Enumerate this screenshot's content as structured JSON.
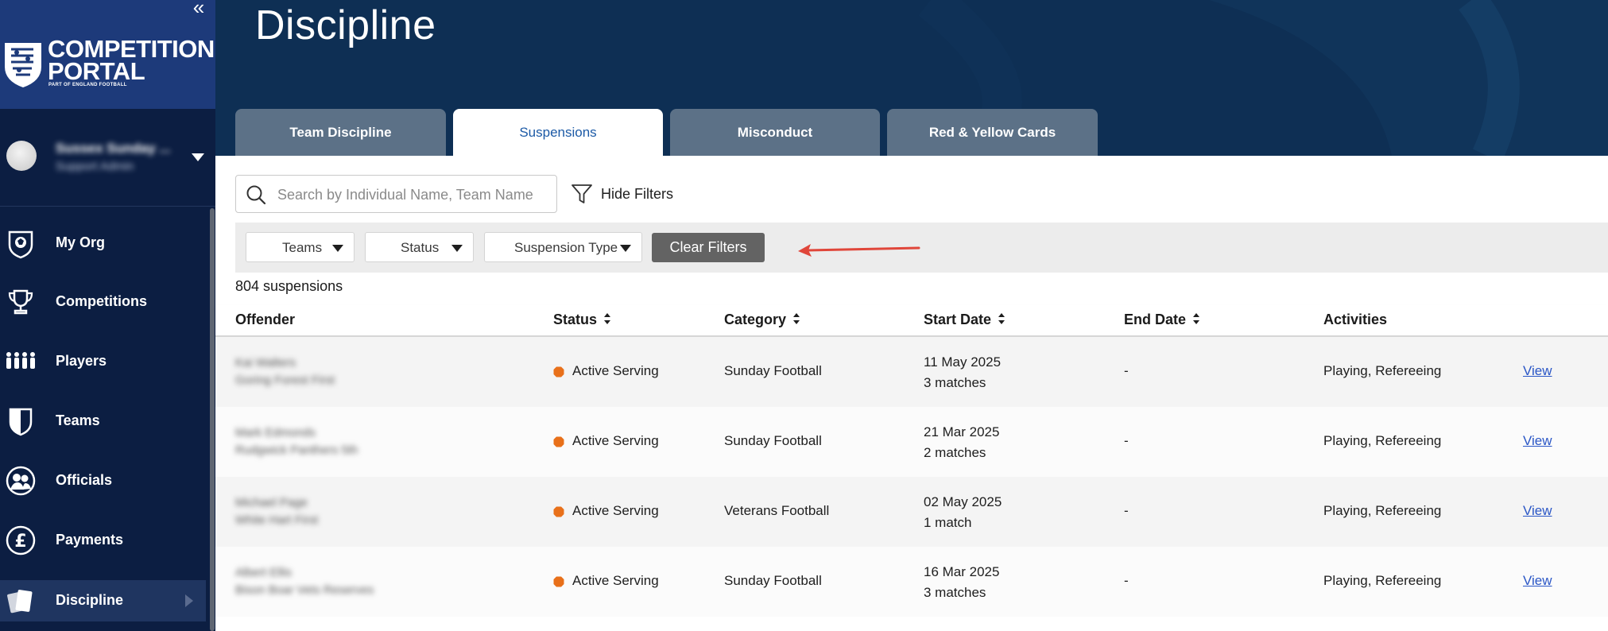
{
  "sidebar": {
    "collapse_glyph": "«",
    "logo": {
      "line1": "COMPETITION",
      "line2": "PORTAL",
      "subline": "PART OF ENGLAND FOOTBALL"
    },
    "user": {
      "name": "Sussex Sunday ...",
      "role": "Support Admin"
    },
    "nav": [
      {
        "label": "My Org",
        "icon": "shield-ball-icon"
      },
      {
        "label": "Competitions",
        "icon": "trophy-icon"
      },
      {
        "label": "Players",
        "icon": "players-icon"
      },
      {
        "label": "Teams",
        "icon": "team-shield-icon"
      },
      {
        "label": "Officials",
        "icon": "officials-icon"
      },
      {
        "label": "Payments",
        "icon": "pound-icon"
      },
      {
        "label": "Discipline",
        "icon": "cards-icon",
        "active": true
      }
    ]
  },
  "header": {
    "title": "Discipline",
    "tabs": [
      {
        "label": "Team Discipline",
        "active": false
      },
      {
        "label": "Suspensions",
        "active": true
      },
      {
        "label": "Misconduct",
        "active": false
      },
      {
        "label": "Red & Yellow Cards",
        "active": false
      }
    ]
  },
  "search": {
    "placeholder": "Search by Individual Name, Team Name",
    "value": ""
  },
  "hide_filters_label": "Hide Filters",
  "filters": {
    "teams": "Teams",
    "status": "Status",
    "suspension_type": "Suspension Type",
    "clear": "Clear Filters"
  },
  "count_label": "804 suspensions",
  "table": {
    "headers": {
      "offender": "Offender",
      "status": "Status",
      "category": "Category",
      "start_date": "Start Date",
      "end_date": "End Date",
      "activities": "Activities"
    },
    "rows": [
      {
        "name": "Kai Walters",
        "team": "Goring Forest First",
        "status": "Active Serving",
        "category": "Sunday Football",
        "start_date": "11 May 2025",
        "matches": "3 matches",
        "end_date": "-",
        "activities": "Playing, Refereeing",
        "action": "View"
      },
      {
        "name": "Mark Edmonds",
        "team": "Rudgwick Panthers 5th",
        "status": "Active Serving",
        "category": "Sunday Football",
        "start_date": "21 Mar 2025",
        "matches": "2 matches",
        "end_date": "-",
        "activities": "Playing, Refereeing",
        "action": "View"
      },
      {
        "name": "Michael Page",
        "team": "White Hart First",
        "status": "Active Serving",
        "category": "Veterans Football",
        "start_date": "02 May 2025",
        "matches": "1 match",
        "end_date": "-",
        "activities": "Playing, Refereeing",
        "action": "View"
      },
      {
        "name": "Albert Ellis",
        "team": "Bison Boar Vets Reserves",
        "status": "Active Serving",
        "category": "Sunday Football",
        "start_date": "16 Mar 2025",
        "matches": "3 matches",
        "end_date": "-",
        "activities": "Playing, Refereeing",
        "action": "View"
      }
    ]
  },
  "colors": {
    "sidebar_bg": "#0c1e42",
    "logo_bg": "#1d3a7a",
    "header_bg": "#0e2f54",
    "tab_inactive": "#5c7187",
    "tab_active_text": "#1c5aa6",
    "status_active": "#e8701a",
    "link": "#2a56c6",
    "annotation_arrow": "#e0463a"
  }
}
